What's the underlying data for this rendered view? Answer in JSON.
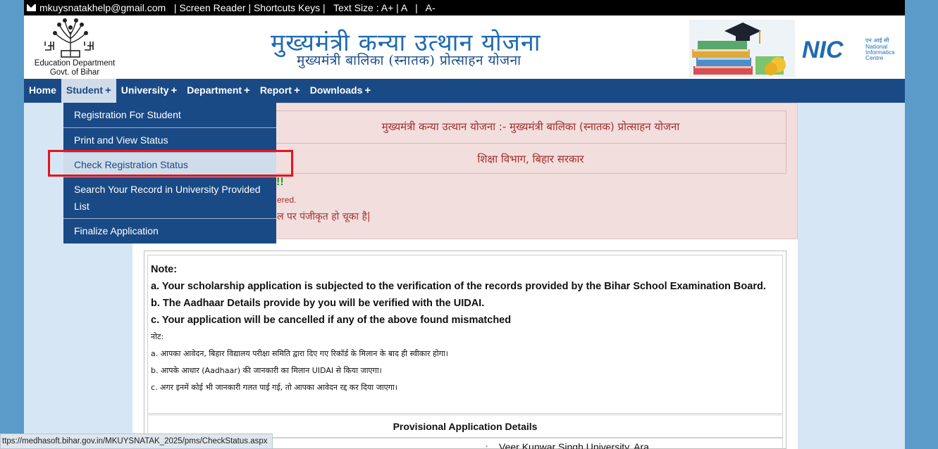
{
  "topbar": {
    "email": "mkuysnatakhelp@gmail.com",
    "links_text": "   | Screen Reader | Shortcuts Keys |   Text Size : A+ | A   |   A-"
  },
  "header": {
    "dept_line1": "Education Department",
    "dept_line2": "Govt. of Bihar",
    "title_main": "मुख्यमंत्री कन्या उत्थान योजना",
    "title_sub": "मुख्यमंत्री बालिका (स्नातक) प्रोत्साहन योजना",
    "nic_hindi": "एन आई सी",
    "nic_line1": "National",
    "nic_line2": "Informatics",
    "nic_line3": "Centre"
  },
  "nav": {
    "items": [
      {
        "label": "Home",
        "plus": ""
      },
      {
        "label": "Student",
        "plus": "+"
      },
      {
        "label": "University",
        "plus": "+"
      },
      {
        "label": "Department",
        "plus": "+"
      },
      {
        "label": "Report",
        "plus": "+"
      },
      {
        "label": "Downloads",
        "plus": "+"
      }
    ]
  },
  "dropdown": {
    "items": [
      {
        "label": "Registration For Student"
      },
      {
        "label": "Print and View Status"
      },
      {
        "label": "Check Registration Status"
      },
      {
        "label": "Search Your Record in University Provided List"
      },
      {
        "label": "Finalize Application"
      }
    ]
  },
  "banner": {
    "row1": "मुख्यमंत्री कन्या उत्थान योजना :- मुख्यमंत्री बालिका (स्नातक) प्रोत्साहन योजना",
    "row2": "शिक्षा विभाग, बिहार सरकार",
    "exclaim": "!!",
    "ered": "ered.",
    "hindi_registered": "ल पर पंजीकृत हो चूका है|"
  },
  "note": {
    "heading": "Note:",
    "a": "a. Your scholarship application is subjected to the verification of the records provided by the Bihar School Examination Board.",
    "b": "b. The Aadhaar Details provide by you will be verified with the UIDAI.",
    "c": "c. Your application will be cancelled if any of the above found mismatched",
    "hindi_heading": "नोट:",
    "hindi_a": "a. आपका आवेदन, बिहार विद्यालय परीक्षा समिति द्वारा दिए गए रिकॉर्ड के मिलान के बाद ही स्वीकार होगा।",
    "hindi_b": "b. आपके आधार (Aadhaar) की जानकारी का मिलान UIDAI से किया जाएगा।",
    "hindi_c": "c. अगर इनमें कोई भी जानकारी गलत पाई गई, तो आपका आवेदन रद्द कर दिया जाएगा।"
  },
  "provisional": {
    "heading": "Provisional Application Details",
    "colon": ":",
    "university_value": "Veer Kunwar Singh University, Ara"
  },
  "statusbar": {
    "url": "ttps://medhasoft.bihar.gov.in/MKUYSNATAK_2025/pms/CheckStatus.aspx"
  }
}
